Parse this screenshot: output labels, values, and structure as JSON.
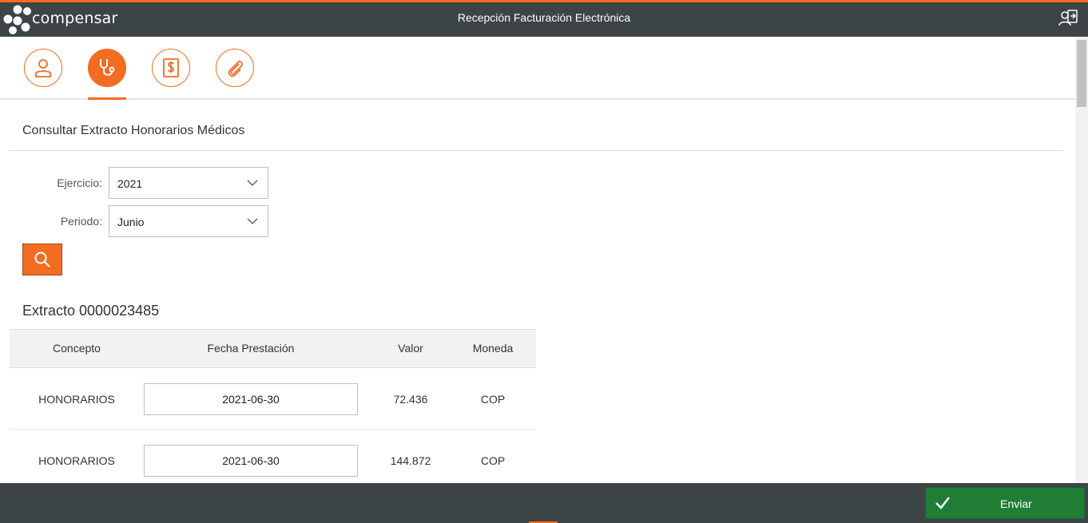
{
  "header": {
    "brand": "compensar",
    "title": "Recepción Facturación Electrónica",
    "logout_icon": "logout-user-icon"
  },
  "tabs": [
    {
      "icon": "user-icon",
      "active": false
    },
    {
      "icon": "stethoscope-icon",
      "active": true
    },
    {
      "icon": "invoice-dollar-icon",
      "active": false
    },
    {
      "icon": "paperclip-icon",
      "active": false
    }
  ],
  "section": {
    "title": "Consultar Extracto Honorarios Médicos"
  },
  "form": {
    "ejercicio_label": "Ejercicio:",
    "ejercicio_value": "2021",
    "periodo_label": "Periodo:",
    "periodo_value": "Junio",
    "search_icon": "search-icon"
  },
  "extract": {
    "title": "Extracto 0000023485",
    "columns": [
      "Concepto",
      "Fecha Prestación",
      "Valor",
      "Moneda"
    ],
    "rows": [
      {
        "concepto": "HONORARIOS",
        "fecha": "2021-06-30",
        "valor": "72.436",
        "moneda": "COP"
      },
      {
        "concepto": "HONORARIOS",
        "fecha": "2021-06-30",
        "valor": "144.872",
        "moneda": "COP"
      }
    ]
  },
  "footer": {
    "send_label": "Enviar"
  },
  "colors": {
    "accent": "#f26c22",
    "header_bg": "#3d4446",
    "send_bg": "#1f7d35"
  }
}
